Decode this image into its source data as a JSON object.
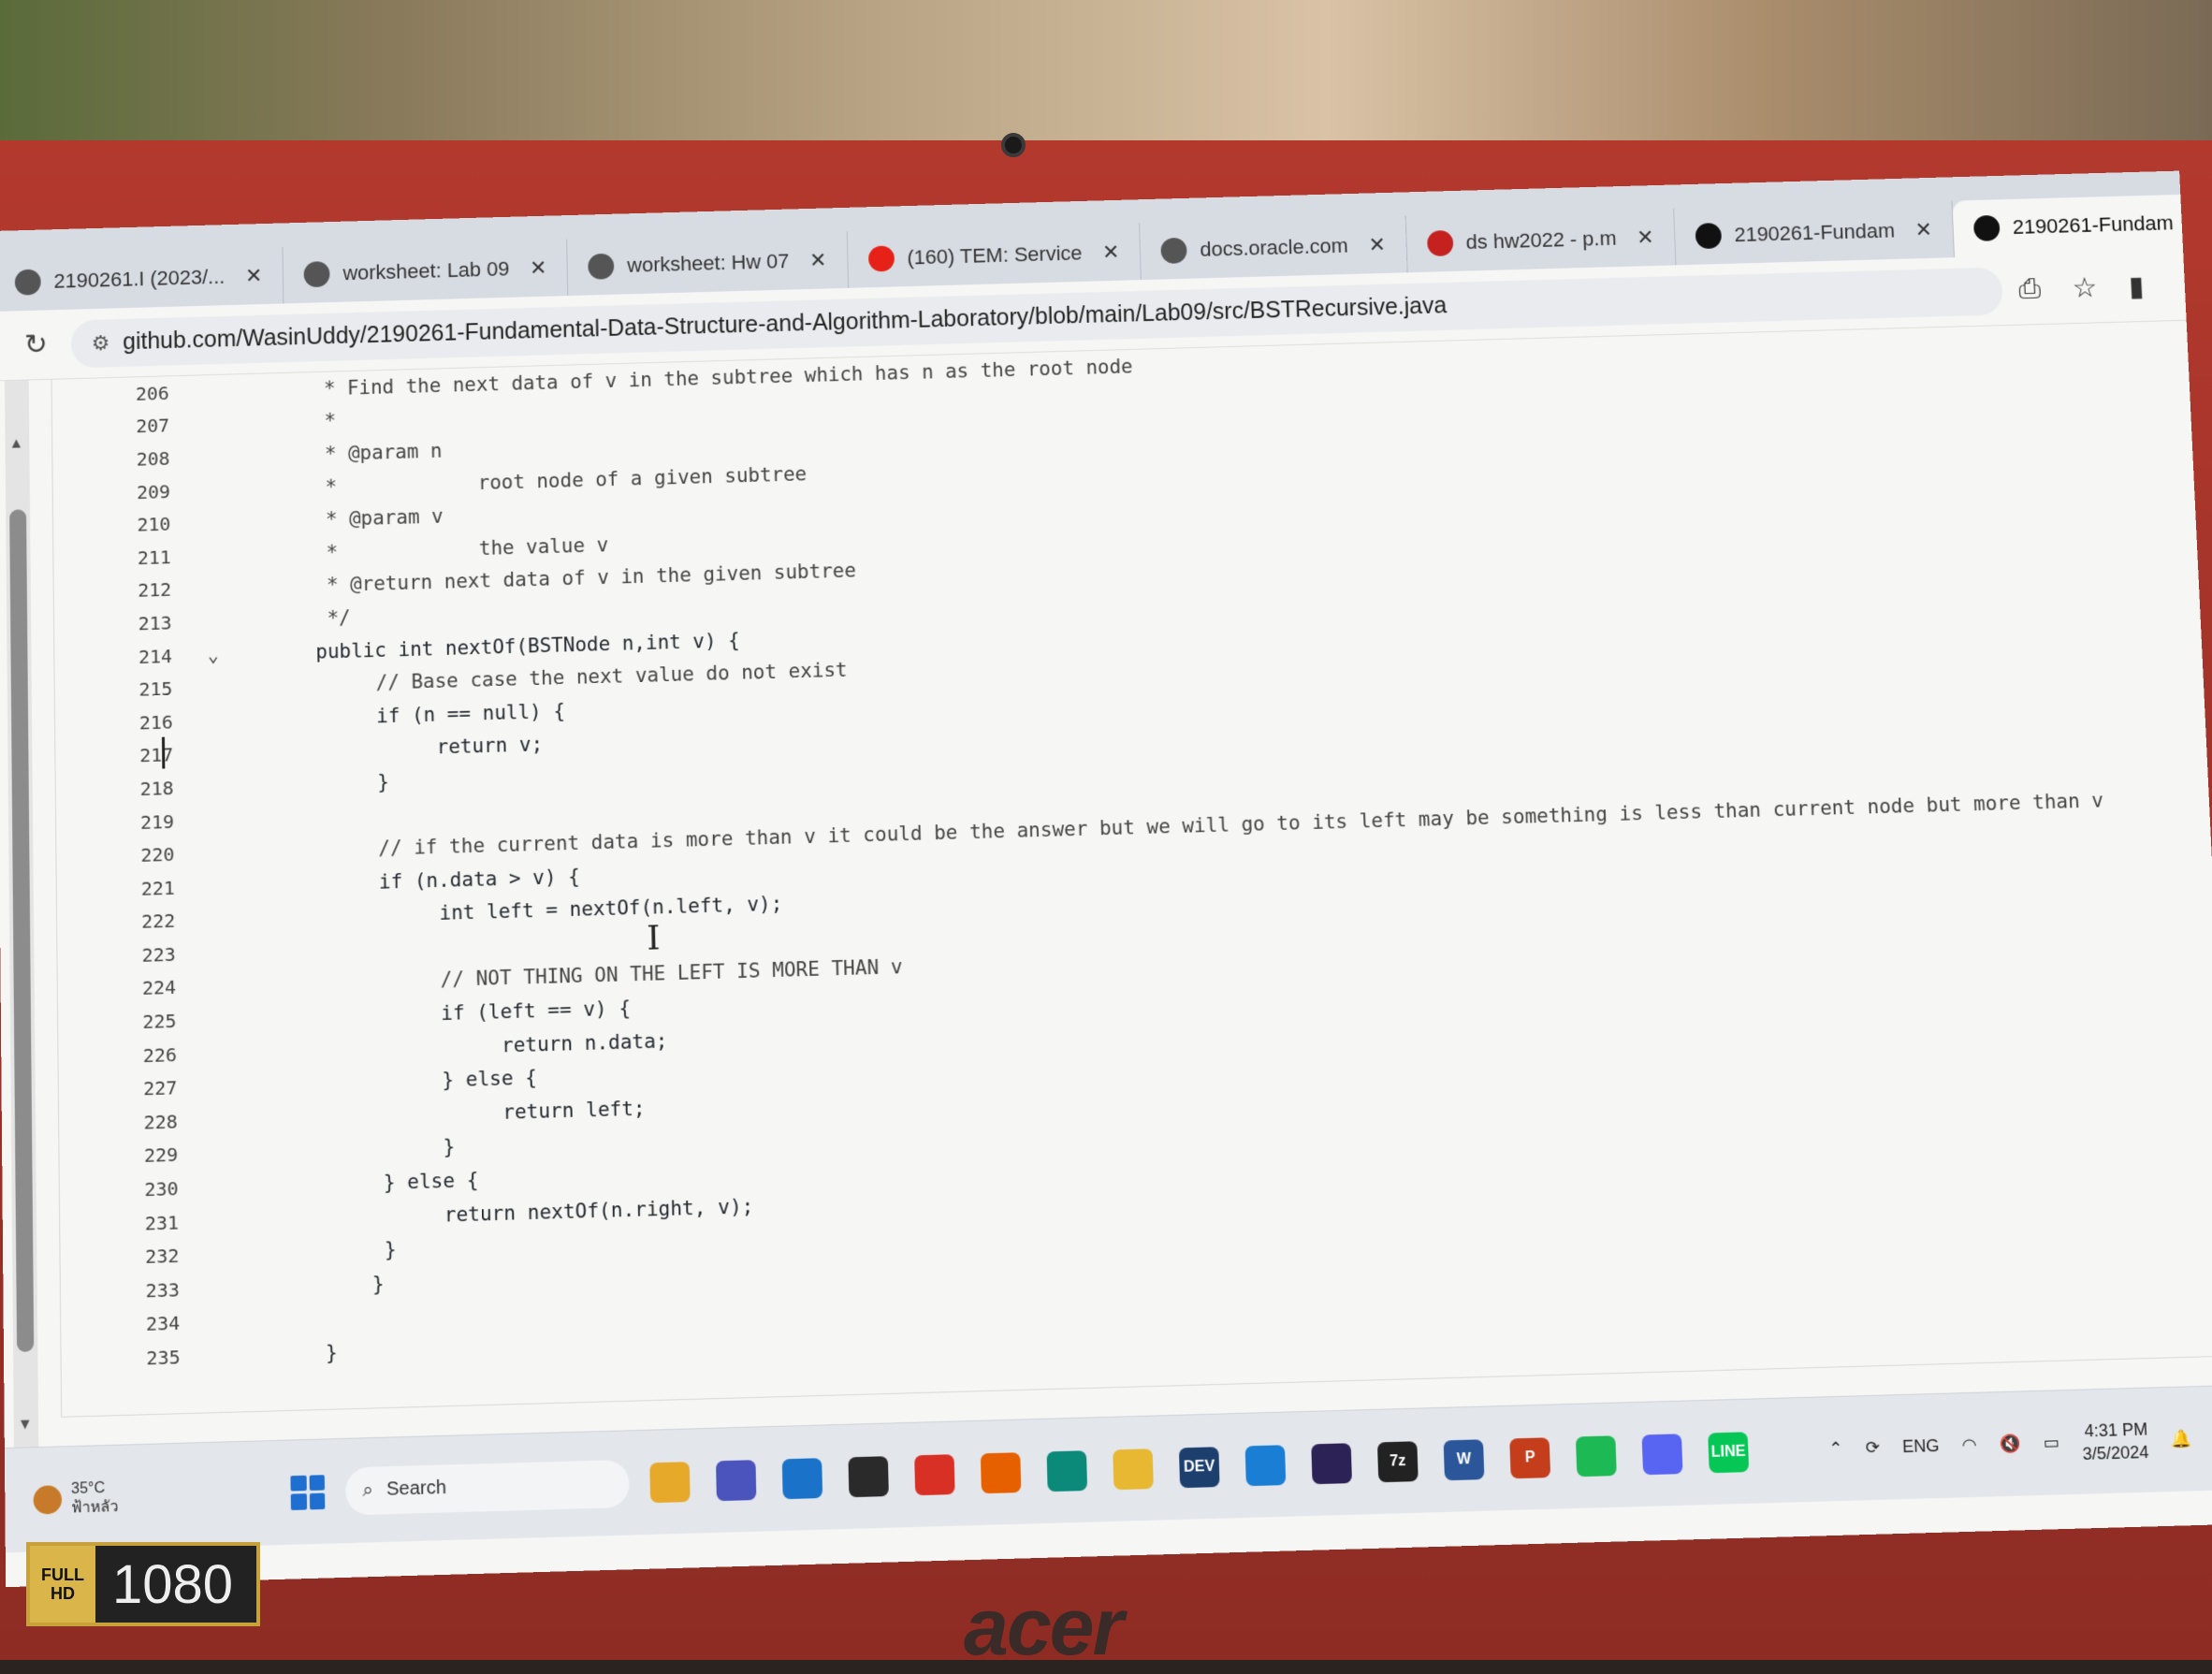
{
  "browser": {
    "tabs": [
      {
        "label": "2190261.I (2023/...",
        "icon": "tab-icon",
        "active": false
      },
      {
        "label": "worksheet: Lab 09",
        "icon": "worksheet-icon",
        "active": false
      },
      {
        "label": "worksheet: Hw 07",
        "icon": "worksheet-icon",
        "active": false
      },
      {
        "label": "(160) TEM: Service",
        "icon": "youtube-icon",
        "active": false
      },
      {
        "label": "docs.oracle.com",
        "icon": "doc-icon",
        "active": false
      },
      {
        "label": "ds hw2022 - p.m",
        "icon": "gmail-icon",
        "active": false
      },
      {
        "label": "2190261-Fundam",
        "icon": "github-icon",
        "active": false
      },
      {
        "label": "2190261-Fundam",
        "icon": "github-icon",
        "active": true
      }
    ],
    "new_tab": "+",
    "minimize": "–",
    "close_glyph": "✕",
    "url": "github.com/WasinUddy/2190261-Fundamental-Data-Structure-and-Algorithm-Laboratory/blob/main/Lab09/src/BSTRecursive.java"
  },
  "code": {
    "lines": [
      {
        "n": "206",
        "indent": 0,
        "text": " * Find the next data of v in the subtree which has n as the root node"
      },
      {
        "n": "207",
        "indent": 0,
        "text": " *"
      },
      {
        "n": "208",
        "indent": 0,
        "text": " * @param n"
      },
      {
        "n": "209",
        "indent": 0,
        "text": " *            root node of a given subtree"
      },
      {
        "n": "210",
        "indent": 0,
        "text": " * @param v"
      },
      {
        "n": "211",
        "indent": 0,
        "text": " *            the value v"
      },
      {
        "n": "212",
        "indent": 0,
        "text": " * @return next data of v in the given subtree"
      },
      {
        "n": "213",
        "indent": 0,
        "text": " */"
      },
      {
        "n": "214",
        "indent": 0,
        "text": "public int nextOf(BSTNode n,int v) {",
        "fold": true
      },
      {
        "n": "215",
        "indent": 1,
        "text": "// Base case the next value do not exist"
      },
      {
        "n": "216",
        "indent": 1,
        "text": "if (n == null) {"
      },
      {
        "n": "217",
        "indent": 2,
        "text": "return v;"
      },
      {
        "n": "218",
        "indent": 1,
        "text": "}"
      },
      {
        "n": "219",
        "indent": 0,
        "text": ""
      },
      {
        "n": "220",
        "indent": 1,
        "text": "// if the current data is more than v it could be the answer but we will go to its left may be something is less than current node but more than v"
      },
      {
        "n": "221",
        "indent": 1,
        "text": "if (n.data > v) {"
      },
      {
        "n": "222",
        "indent": 2,
        "text": "int left = nextOf(n.left, v);"
      },
      {
        "n": "223",
        "indent": 0,
        "text": ""
      },
      {
        "n": "224",
        "indent": 2,
        "text": "// NOT THING ON THE LEFT IS MORE THAN v"
      },
      {
        "n": "225",
        "indent": 2,
        "text": "if (left == v) {"
      },
      {
        "n": "226",
        "indent": 3,
        "text": "return n.data;"
      },
      {
        "n": "227",
        "indent": 2,
        "text": "} else {"
      },
      {
        "n": "228",
        "indent": 3,
        "text": "return left;"
      },
      {
        "n": "229",
        "indent": 2,
        "text": "}"
      },
      {
        "n": "230",
        "indent": 1,
        "text": "} else {"
      },
      {
        "n": "231",
        "indent": 2,
        "text": "return nextOf(n.right, v);"
      },
      {
        "n": "232",
        "indent": 1,
        "text": "}"
      },
      {
        "n": "233",
        "indent": 0,
        "text": "    }"
      },
      {
        "n": "234",
        "indent": 0,
        "text": ""
      },
      {
        "n": "235",
        "indent": 0,
        "text": "}"
      }
    ]
  },
  "taskbar": {
    "weather_temp": "35°C",
    "weather_desc": "ฟ้าหลัว",
    "search_label": "Search",
    "apps": [
      {
        "name": "file-explorer-icon",
        "color": "#e6a92a",
        "glyph": ""
      },
      {
        "name": "chat-icon",
        "color": "#4b53bc",
        "glyph": ""
      },
      {
        "name": "mail-icon",
        "color": "#1a73c9",
        "glyph": ""
      },
      {
        "name": "store-icon",
        "color": "#2a2a2a",
        "glyph": ""
      },
      {
        "name": "chrome-icon",
        "color": "#d93025",
        "glyph": ""
      },
      {
        "name": "firefox-icon",
        "color": "#e66000",
        "glyph": ""
      },
      {
        "name": "edge-icon",
        "color": "#0b8a7a",
        "glyph": ""
      },
      {
        "name": "folder-icon",
        "color": "#e8b832",
        "glyph": ""
      },
      {
        "name": "dev-icon",
        "color": "#1c3f6e",
        "glyph": "DEV"
      },
      {
        "name": "vscode-icon",
        "color": "#1a7fd4",
        "glyph": ""
      },
      {
        "name": "eclipse-icon",
        "color": "#2c2255",
        "glyph": ""
      },
      {
        "name": "7zip-icon",
        "color": "#222222",
        "glyph": "7z"
      },
      {
        "name": "word-icon",
        "color": "#2b579a",
        "glyph": "W"
      },
      {
        "name": "powerpoint-icon",
        "color": "#c43e1c",
        "glyph": "P"
      },
      {
        "name": "spotify-icon",
        "color": "#1db954",
        "glyph": ""
      },
      {
        "name": "discord-icon",
        "color": "#5865f2",
        "glyph": ""
      },
      {
        "name": "line-icon",
        "color": "#06c755",
        "glyph": "LINE"
      }
    ],
    "language": "ENG",
    "time": "4:31 PM",
    "date": "3/5/2024"
  },
  "bezel": {
    "badge_top": "FULL",
    "badge_hd": "HD",
    "badge_res": "1080",
    "brand": "acer"
  }
}
